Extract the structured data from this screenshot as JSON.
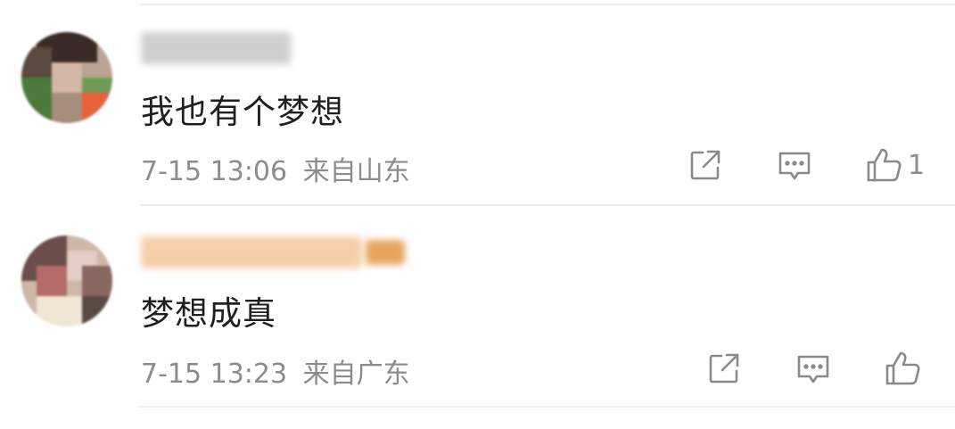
{
  "comments": [
    {
      "username_blurred": true,
      "text": "我也有个梦想",
      "time": "7-15 13:06",
      "location": "来自山东",
      "like_count": "1",
      "name_color": "#c9c9c9"
    },
    {
      "username_blurred": true,
      "text": "梦想成真",
      "time": "7-15 13:23",
      "location": "来自广东",
      "like_count": "",
      "name_color": "#f3c9a3"
    }
  ],
  "icons": {
    "share": "share-icon",
    "comment": "comment-icon",
    "like": "like-icon"
  },
  "colors": {
    "text": "#1f1f1f",
    "meta": "#8c8c8c",
    "icon": "#8a8a8a",
    "divider": "#ececec"
  }
}
